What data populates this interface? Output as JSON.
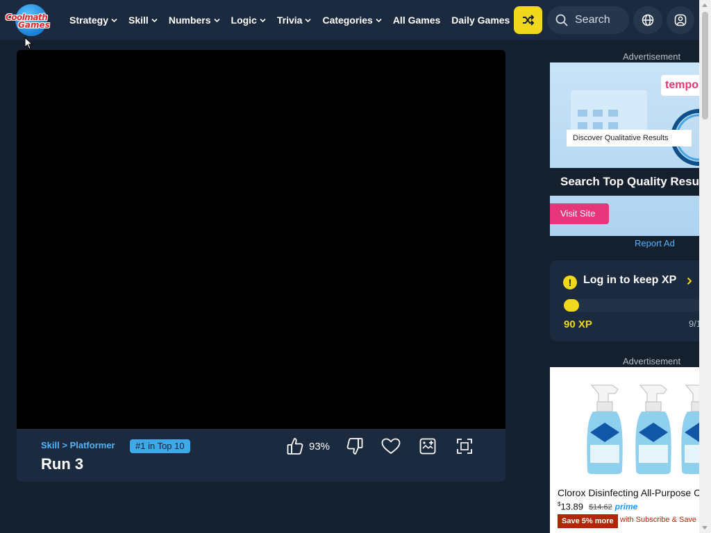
{
  "header": {
    "logo_line1": "Coolmath",
    "logo_line2": "Games",
    "nav": [
      {
        "label": "Strategy",
        "has_dropdown": true
      },
      {
        "label": "Skill",
        "has_dropdown": true
      },
      {
        "label": "Numbers",
        "has_dropdown": true
      },
      {
        "label": "Logic",
        "has_dropdown": true
      },
      {
        "label": "Trivia",
        "has_dropdown": true
      },
      {
        "label": "Categories",
        "has_dropdown": true
      },
      {
        "label": "All Games",
        "has_dropdown": false
      },
      {
        "label": "Daily Games",
        "has_dropdown": false
      }
    ],
    "search_label": "Search",
    "icons": {
      "random": "shuffle-icon",
      "search": "search-icon",
      "language": "globe-icon",
      "account": "user-icon"
    }
  },
  "game": {
    "breadcrumb_category": "Skill",
    "breadcrumb_separator": ">",
    "breadcrumb_subcategory": "Platformer",
    "badge": "#1 in Top 10",
    "title": "Run 3",
    "like_percent": "93%",
    "icons": {
      "like": "thumbs-up-icon",
      "dislike": "thumbs-down-icon",
      "favorite": "heart-icon",
      "add": "add-to-list-icon",
      "fullscreen": "fullscreen-icon"
    }
  },
  "ads": {
    "label": "Advertisement",
    "report": "Report Ad",
    "ad1": {
      "brand": "tempo",
      "pill_text": "Discover Qualitative Results",
      "headline": "Search Top Quality Resu",
      "button": "Visit Site"
    },
    "ad2": {
      "title": "Clorox Disinfecting All-Purpose C",
      "price_currency": "$",
      "price": "13.89",
      "old_price": "$14.62",
      "prime": "prime",
      "save_badge": "Save 5% more",
      "save_text": "with Subscribe & Save"
    }
  },
  "xp": {
    "title": "Log in to keep XP",
    "value": "90 XP",
    "date": "9/1",
    "progress": 0.05,
    "warning_icon": "warning-icon",
    "chevron_icon": "chevron-right-icon"
  },
  "colors": {
    "page_bg": "#15202f",
    "header_bg": "#1b2a3e",
    "accent_yellow": "#f2d81c",
    "link_blue": "#4fb5ff",
    "ad_pink": "#e6357a"
  }
}
